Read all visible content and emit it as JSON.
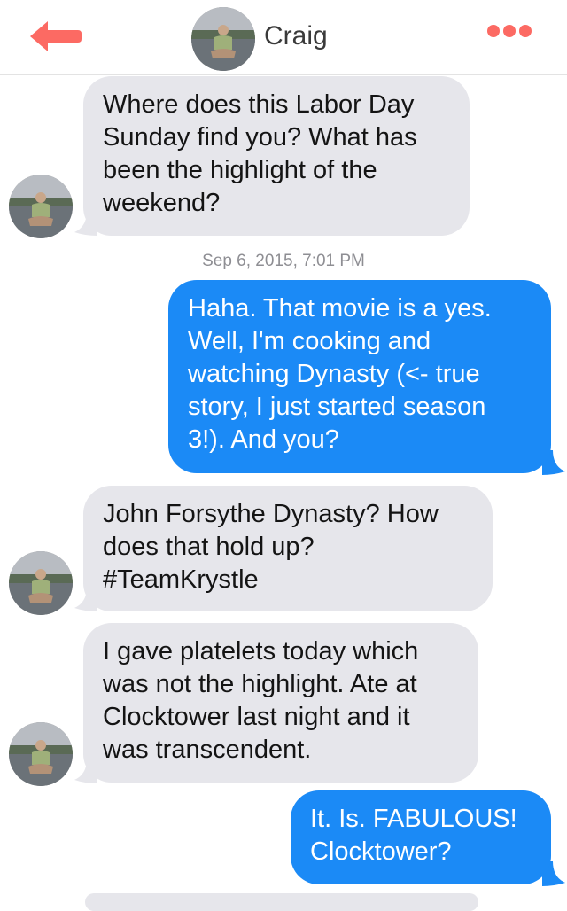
{
  "header": {
    "contact_name": "Craig",
    "back_icon": "back-arrow-icon",
    "more_icon": "more-dots-icon",
    "accent_color": "#fc6a63"
  },
  "thread": {
    "timestamp": "Sep 6, 2015, 7:01 PM",
    "messages": [
      {
        "from": "Craig",
        "direction": "incoming",
        "text": "Where does this Labor Day\nSunday find you? What has\nbeen the highlight of the\nweekend?"
      },
      {
        "from": "me",
        "direction": "outgoing",
        "text": "Haha. That movie is a yes.\nWell, I'm cooking and\nwatching Dynasty (<- true\nstory,  I just started season\n3!). And you?"
      },
      {
        "from": "Craig",
        "direction": "incoming",
        "text": "John Forsythe Dynasty? How\ndoes that hold up?\n#TeamKrystle"
      },
      {
        "from": "Craig",
        "direction": "incoming",
        "text": "I gave platelets today which\nwas not the highlight. Ate at\nClocktower last night and it\nwas transcendent."
      },
      {
        "from": "me",
        "direction": "outgoing",
        "text": "It. Is. FABULOUS!\nClocktower?"
      }
    ]
  },
  "colors": {
    "incoming_bubble": "#e6e6eb",
    "outgoing_bubble": "#1b8af6"
  }
}
